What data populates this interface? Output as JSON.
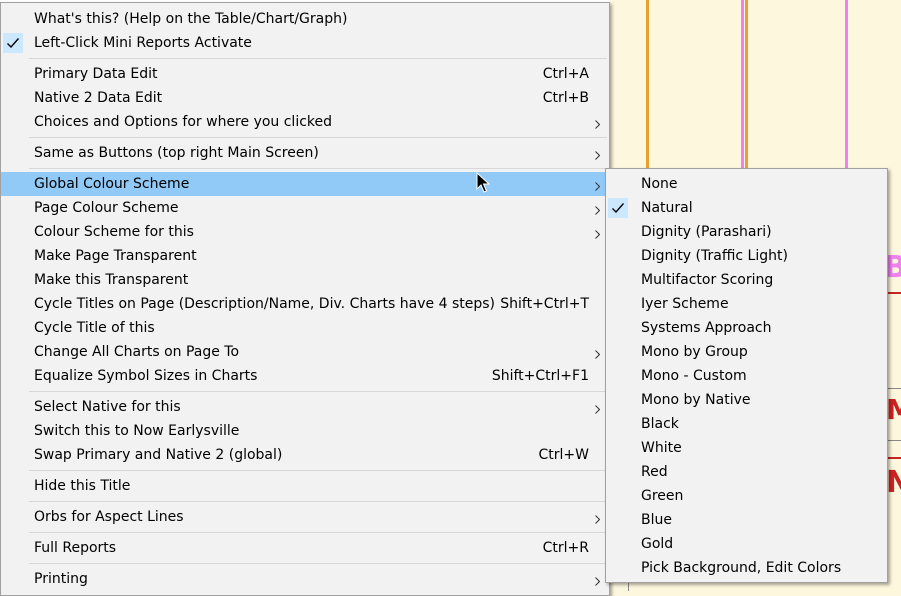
{
  "main_menu": {
    "items": [
      {
        "label": "What's this? (Help on the Table/Chart/Graph)",
        "shortcut": "",
        "submenu": false,
        "checked": false
      },
      {
        "label": "Left-Click Mini Reports Activate",
        "shortcut": "",
        "submenu": false,
        "checked": true
      },
      {
        "label": "Primary Data Edit",
        "shortcut": "Ctrl+A",
        "submenu": false,
        "checked": false
      },
      {
        "label": "Native 2 Data Edit",
        "shortcut": "Ctrl+B",
        "submenu": false,
        "checked": false
      },
      {
        "label": "Choices and Options for where you clicked",
        "shortcut": "",
        "submenu": true,
        "checked": false
      },
      {
        "label": "Same as Buttons (top right Main Screen)",
        "shortcut": "",
        "submenu": true,
        "checked": false
      },
      {
        "label": "Global Colour Scheme",
        "shortcut": "",
        "submenu": true,
        "checked": false,
        "highlighted": true
      },
      {
        "label": "Page Colour Scheme",
        "shortcut": "",
        "submenu": true,
        "checked": false
      },
      {
        "label": "Colour Scheme for this",
        "shortcut": "",
        "submenu": true,
        "checked": false
      },
      {
        "label": "Make Page Transparent",
        "shortcut": "",
        "submenu": false,
        "checked": false
      },
      {
        "label": "Make this Transparent",
        "shortcut": "",
        "submenu": false,
        "checked": false
      },
      {
        "label": "Cycle Titles on Page (Description/Name, Div. Charts have 4 steps)",
        "shortcut": "Shift+Ctrl+T",
        "submenu": false,
        "checked": false
      },
      {
        "label": "Cycle Title of this",
        "shortcut": "",
        "submenu": false,
        "checked": false
      },
      {
        "label": "Change All Charts on Page To",
        "shortcut": "",
        "submenu": true,
        "checked": false
      },
      {
        "label": "Equalize Symbol Sizes in Charts",
        "shortcut": "Shift+Ctrl+F1",
        "submenu": false,
        "checked": false
      },
      {
        "label": "Select Native for this",
        "shortcut": "",
        "submenu": true,
        "checked": false
      },
      {
        "label": "Switch this to Now Earlysville",
        "shortcut": "",
        "submenu": false,
        "checked": false
      },
      {
        "label": "Swap Primary and Native 2 (global)",
        "shortcut": "Ctrl+W",
        "submenu": false,
        "checked": false
      },
      {
        "label": "Hide this Title",
        "shortcut": "",
        "submenu": false,
        "checked": false
      },
      {
        "label": "Orbs for Aspect Lines",
        "shortcut": "",
        "submenu": true,
        "checked": false
      },
      {
        "label": "Full Reports",
        "shortcut": "Ctrl+R",
        "submenu": false,
        "checked": false
      },
      {
        "label": "Printing",
        "shortcut": "",
        "submenu": true,
        "checked": false
      }
    ]
  },
  "colour_submenu": {
    "items": [
      {
        "label": "None",
        "checked": false
      },
      {
        "label": "Natural",
        "checked": true
      },
      {
        "label": "Dignity (Parashari)",
        "checked": false
      },
      {
        "label": "Dignity (Traffic Light)",
        "checked": false
      },
      {
        "label": "Multifactor Scoring",
        "checked": false
      },
      {
        "label": "Iyer Scheme",
        "checked": false
      },
      {
        "label": "Systems Approach",
        "checked": false
      },
      {
        "label": "Mono by Group",
        "checked": false
      },
      {
        "label": "Mono - Custom",
        "checked": false
      },
      {
        "label": "Mono by Native",
        "checked": false
      },
      {
        "label": "Black",
        "checked": false
      },
      {
        "label": "White",
        "checked": false
      },
      {
        "label": "Red",
        "checked": false
      },
      {
        "label": "Green",
        "checked": false
      },
      {
        "label": "Blue",
        "checked": false
      },
      {
        "label": "Gold",
        "checked": false
      },
      {
        "label": "Pick Background, Edit Colors",
        "checked": false
      }
    ]
  },
  "background": {
    "glyphs": [
      "Be",
      "M",
      "N"
    ]
  },
  "colors": {
    "menu_bg": "#f2f2f2",
    "highlight": "#91c9f7",
    "check_bg": "#cce8ff",
    "canvas": "#fdf7dd",
    "accent_pink": "#f080f0",
    "accent_red": "#cc2222"
  }
}
